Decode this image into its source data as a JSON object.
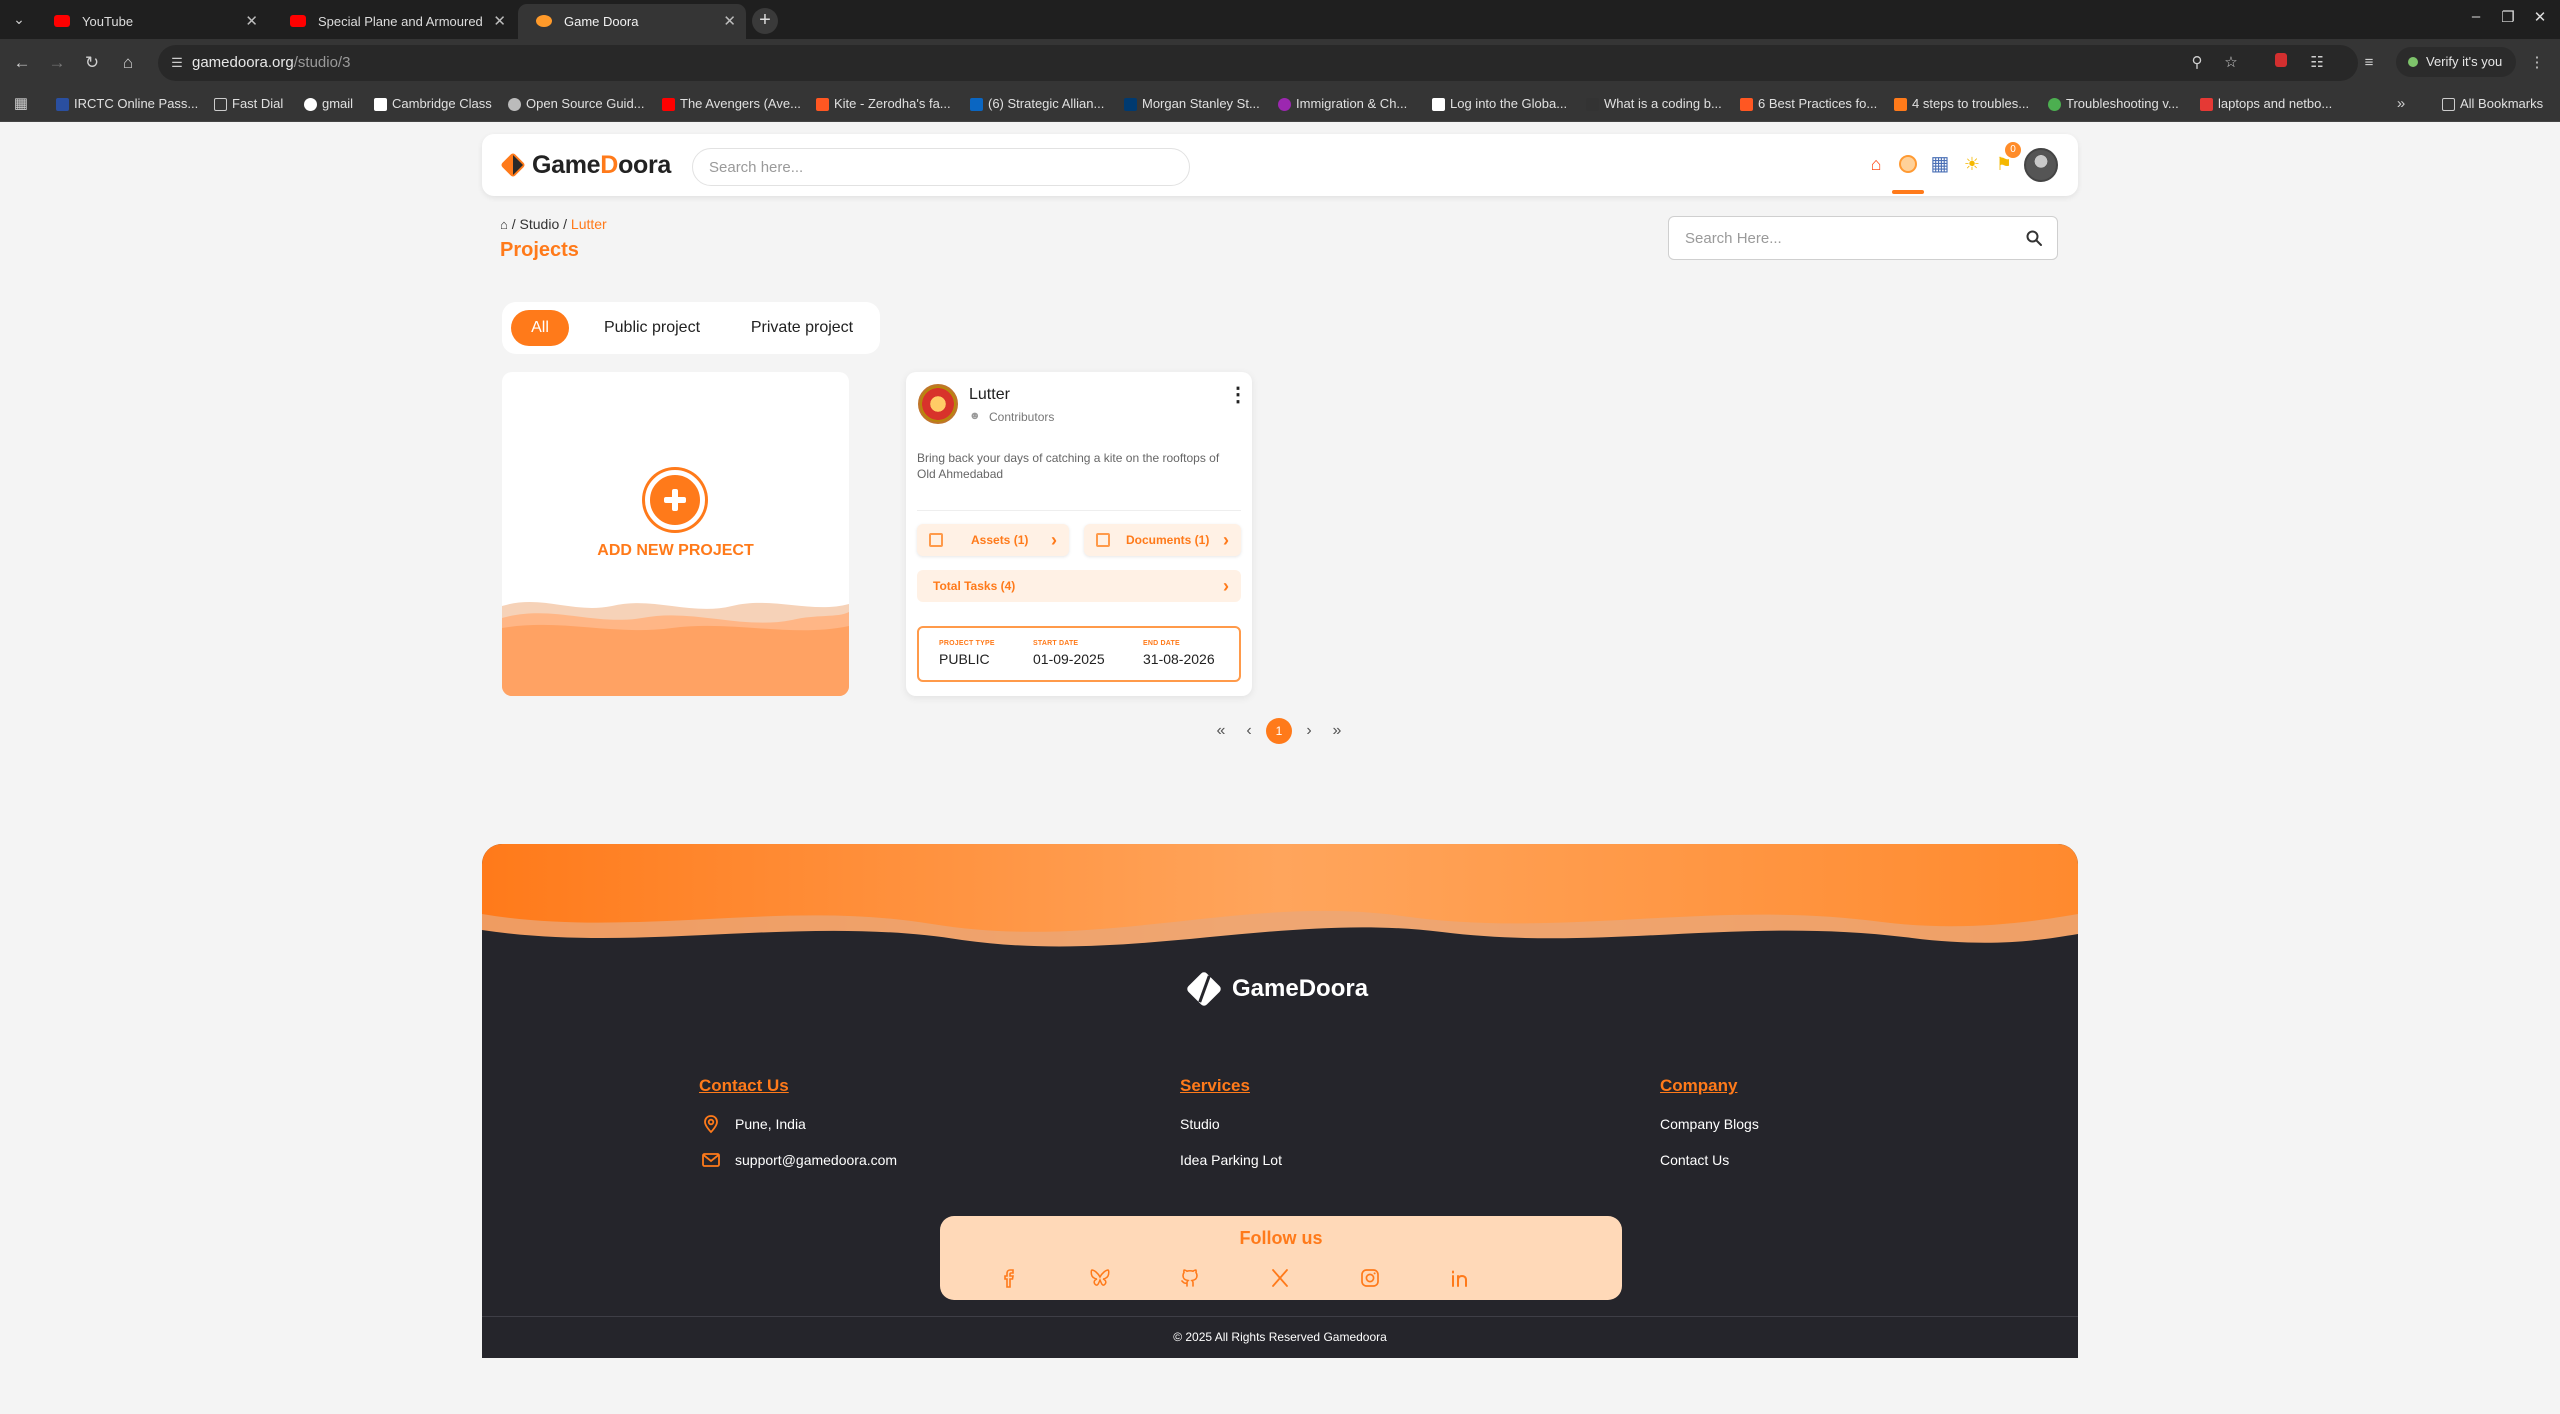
{
  "browser": {
    "tabs": [
      {
        "title": "YouTube",
        "active": false,
        "favicon_color": "#ff0000"
      },
      {
        "title": "Special Plane and Armoured",
        "active": false,
        "favicon_color": "#ff0000"
      },
      {
        "title": "Game Doora",
        "active": true,
        "favicon_color": "#ff9a2a"
      }
    ],
    "url_host": "gamedoora.org",
    "url_path": "/studio/3",
    "verify_label": "Verify it's you",
    "bookmarks": [
      {
        "label": "IRCTC Online Pass...",
        "color": "#2a4fa0"
      },
      {
        "label": "Fast Dial",
        "color": "#888888"
      },
      {
        "label": "gmail",
        "color": "#ffffff"
      },
      {
        "label": "Cambridge Class",
        "color": "#ffffff"
      },
      {
        "label": "Open Source Guid...",
        "color": "#bbbbbb"
      },
      {
        "label": "The Avengers (Ave...",
        "color": "#ff0000"
      },
      {
        "label": "Kite - Zerodha's fa...",
        "color": "#ff5722"
      },
      {
        "label": "(6) Strategic Allian...",
        "color": "#0a66c2"
      },
      {
        "label": "Morgan Stanley St...",
        "color": "#003a70"
      },
      {
        "label": "Immigration & Ch...",
        "color": "#9c27b0"
      },
      {
        "label": "Log into the Globa...",
        "color": "#ffffff"
      },
      {
        "label": "What is a coding b...",
        "color": "#333333"
      },
      {
        "label": "6 Best Practices fo...",
        "color": "#ff5722"
      },
      {
        "label": "4 steps to troubles...",
        "color": "#ff7a1a"
      },
      {
        "label": "Troubleshooting v...",
        "color": "#4caf50"
      },
      {
        "label": "laptops and netbo...",
        "color": "#e53935"
      }
    ],
    "all_bookmarks_label": "All Bookmarks"
  },
  "app": {
    "brand_part1": "Game",
    "brand_o": "D",
    "brand_part2": "oora",
    "search_placeholder": "Search here...",
    "notification_count": "0"
  },
  "breadcrumb": {
    "studio": "Studio",
    "current": "Lutter",
    "sep": "/"
  },
  "page_title": "Projects",
  "project_search_placeholder": "Search Here...",
  "filters": {
    "all": "All",
    "public": "Public project",
    "private": "Private project"
  },
  "add_project_label": "ADD NEW PROJECT",
  "project": {
    "title": "Lutter",
    "contributors_label": "Contributors",
    "description": "Bring back your days of catching a kite on the rooftops of Old Ahmedabad",
    "assets_label": "Assets (1)",
    "documents_label": "Documents (1)",
    "tasks_label": "Total Tasks (4)",
    "type_key": "PROJECT TYPE",
    "type_value": "PUBLIC",
    "start_key": "START DATE",
    "start_value": "01-09-2025",
    "end_key": "END DATE",
    "end_value": "31-08-2026"
  },
  "pagination": {
    "current_page": "1"
  },
  "footer": {
    "brand": "GameDoora",
    "contact_heading": "Contact Us",
    "location": "Pune, India",
    "email": "support@gamedoora.com",
    "services_heading": "Services",
    "services": [
      "Studio",
      "Idea Parking Lot"
    ],
    "company_heading": "Company",
    "company": [
      "Company Blogs",
      "Contact Us"
    ],
    "follow_heading": "Follow us",
    "copyright": "© 2025 All Rights Reserved Gamedoora"
  },
  "colors": {
    "accent": "#ff7a1a",
    "footer_bg": "#25252b",
    "follow_bg": "#ffd9b8"
  }
}
